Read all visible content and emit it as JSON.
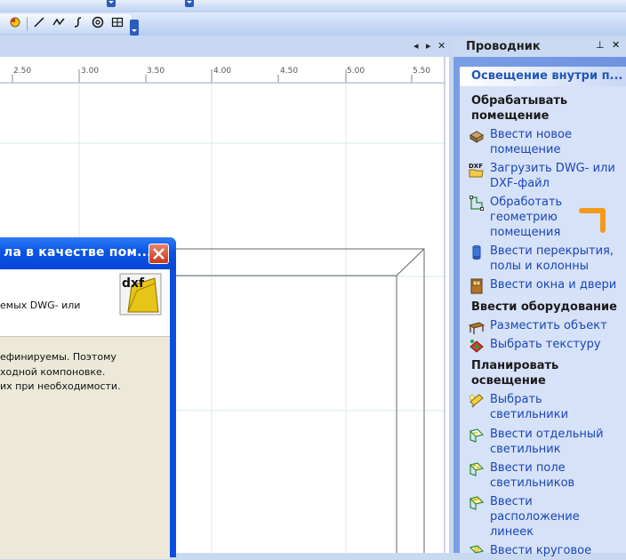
{
  "ruler": {
    "labels": [
      "2.50",
      "3.00",
      "3.50",
      "4.00",
      "4.50",
      "5.00",
      "5.50"
    ]
  },
  "dialog": {
    "title": "ла в качестве пом...",
    "top_line1": "емых DWG- или",
    "body_line1": "ефинируемы. Поэтому",
    "body_line2": "ходной компоновке.",
    "body_line3": "их при необходимости.",
    "icon_text": "dxf"
  },
  "explorer": {
    "title": "Проводник",
    "header": "Освещение внутри п...",
    "sections": [
      {
        "title": "Обрабатывать помещение",
        "items": [
          {
            "label": "Ввести новое помещение",
            "icon": "room-icon"
          },
          {
            "label": "Загрузить DWG- или DXF-файл",
            "icon": "dxf-folder-icon"
          },
          {
            "label": "Обработать геометрию помещения",
            "icon": "geometry-icon"
          },
          {
            "label": "Ввести перекрытия, полы и колонны",
            "icon": "column-icon"
          },
          {
            "label": "Ввести окна и двери",
            "icon": "door-icon"
          }
        ]
      },
      {
        "title": "Ввести оборудование",
        "items": [
          {
            "label": "Разместить объект",
            "icon": "table-icon"
          },
          {
            "label": "Выбрать текстуру",
            "icon": "texture-icon"
          }
        ]
      },
      {
        "title": "Планировать освещение",
        "items": [
          {
            "label": "Выбрать светильники",
            "icon": "luminaire-icon"
          },
          {
            "label": "Ввести отдельный светильник",
            "icon": "single-luminaire-icon"
          },
          {
            "label": "Ввести поле светильников",
            "icon": "luminaire-field-icon"
          },
          {
            "label": "Ввести расположение линеек",
            "icon": "line-arrangement-icon"
          },
          {
            "label": "Ввести круговое",
            "icon": "circular-icon"
          }
        ]
      }
    ]
  },
  "colors": {
    "accent_link": "#1a46b5",
    "title_bar": "#0b55e5",
    "arrow": "#f39a1c"
  }
}
